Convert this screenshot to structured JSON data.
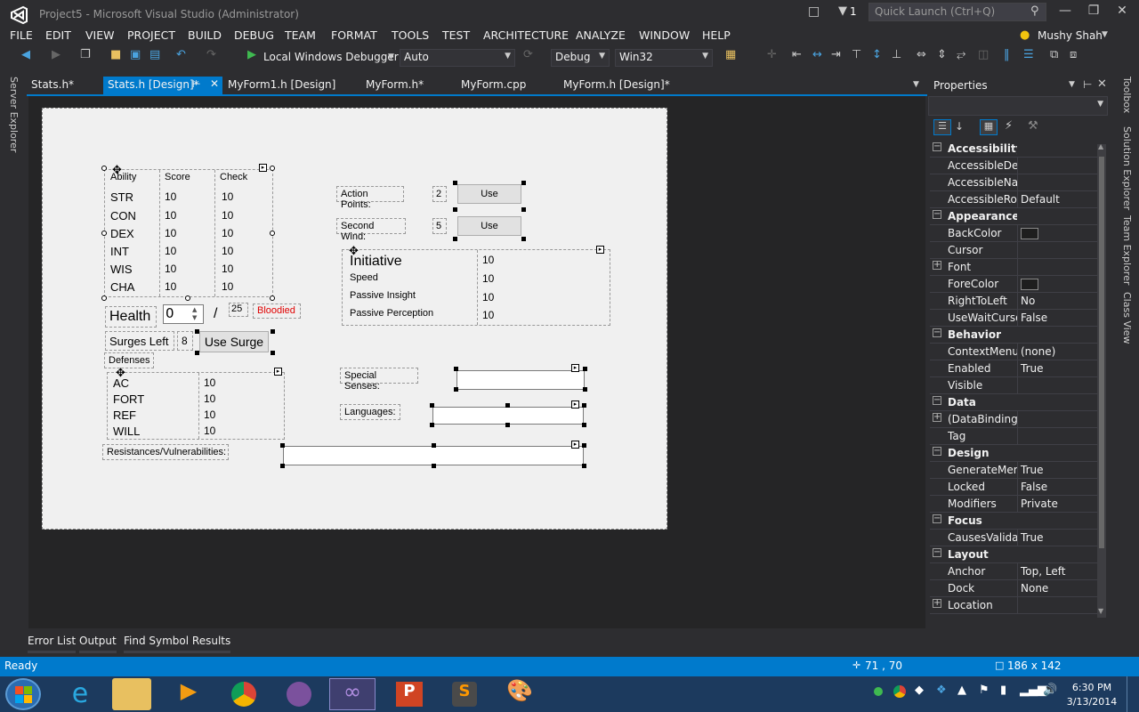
{
  "window": {
    "title": "Project5 - Microsoft Visual Studio (Administrator)",
    "notification_count": "1",
    "quick_launch_placeholder": "Quick Launch (Ctrl+Q)"
  },
  "menu": [
    "FILE",
    "EDIT",
    "VIEW",
    "PROJECT",
    "BUILD",
    "DEBUG",
    "TEAM",
    "FORMAT",
    "TOOLS",
    "TEST",
    "ARCHITECTURE",
    "ANALYZE",
    "WINDOW",
    "HELP"
  ],
  "user": "Mushy Shah",
  "toolbar": {
    "debugger": "Local Windows Debugger",
    "solution_platform_combo": "Auto",
    "config": "Debug",
    "platform": "Win32"
  },
  "side_panel_left": "Server Explorer",
  "tabs": [
    "Stats.h*",
    "Stats.h [Design]*",
    "MyForm1.h [Design]",
    "MyForm.h*",
    "MyForm.cpp",
    "MyForm.h [Design]*"
  ],
  "form": {
    "ability_table": {
      "headers": [
        "Ability",
        "Score",
        "Check"
      ],
      "rows": [
        [
          "STR",
          "10",
          "10"
        ],
        [
          "CON",
          "10",
          "10"
        ],
        [
          "DEX",
          "10",
          "10"
        ],
        [
          "INT",
          "10",
          "10"
        ],
        [
          "WIS",
          "10",
          "10"
        ],
        [
          "CHA",
          "10",
          "10"
        ]
      ]
    },
    "health_label": "Health",
    "health_value": "0",
    "health_sep": "/",
    "health_max": "25",
    "bloodied": "Bloodied",
    "surges_label": "Surges Left",
    "surges_value": "8",
    "use_surge": "Use Surge",
    "defenses_label": "Defenses",
    "defenses_table": [
      [
        "AC",
        "10"
      ],
      [
        "FORT",
        "10"
      ],
      [
        "REF",
        "10"
      ],
      [
        "WILL",
        "10"
      ]
    ],
    "resistances_label": "Resistances/Vulnerabilities:",
    "action_points_label": "Action Points:",
    "action_points_value": "2",
    "second_wind_label": "Second Wind:",
    "second_wind_value": "5",
    "use_label": "Use",
    "initiative_table": [
      [
        "Initiative",
        "10"
      ],
      [
        "Speed",
        "10"
      ],
      [
        "Passive Insight",
        "10"
      ],
      [
        "Passive Perception",
        "10"
      ]
    ],
    "special_senses_label": "Special Senses:",
    "languages_label": "Languages:"
  },
  "properties": {
    "title": "Properties",
    "rows": [
      {
        "cat": "Accessibility"
      },
      {
        "name": "AccessibleDesc",
        "value": ""
      },
      {
        "name": "AccessibleNam",
        "value": ""
      },
      {
        "name": "AccessibleRole",
        "value": "Default"
      },
      {
        "cat": "Appearance"
      },
      {
        "name": "BackColor",
        "value": "",
        "swatch": true
      },
      {
        "name": "Cursor",
        "value": ""
      },
      {
        "name": "Font",
        "value": "",
        "expand": true
      },
      {
        "name": "ForeColor",
        "value": "",
        "swatch": true
      },
      {
        "name": "RightToLeft",
        "value": "No"
      },
      {
        "name": "UseWaitCursor",
        "value": "False"
      },
      {
        "cat": "Behavior"
      },
      {
        "name": "ContextMenuS",
        "value": "(none)"
      },
      {
        "name": "Enabled",
        "value": "True"
      },
      {
        "name": "Visible",
        "value": ""
      },
      {
        "cat": "Data"
      },
      {
        "name": "(DataBindings)",
        "value": "",
        "expand": true
      },
      {
        "name": "Tag",
        "value": ""
      },
      {
        "cat": "Design"
      },
      {
        "name": "GenerateMeml",
        "value": "True"
      },
      {
        "name": "Locked",
        "value": "False"
      },
      {
        "name": "Modifiers",
        "value": "Private"
      },
      {
        "cat": "Focus"
      },
      {
        "name": "CausesValidati",
        "value": "True"
      },
      {
        "cat": "Layout"
      },
      {
        "name": "Anchor",
        "value": "Top, Left"
      },
      {
        "name": "Dock",
        "value": "None"
      },
      {
        "name": "Location",
        "value": "",
        "expand": true
      }
    ]
  },
  "right_strip": [
    "Toolbox",
    "Solution Explorer",
    "Team Explorer",
    "Class View"
  ],
  "bottom_tabs": [
    "Error List",
    "Output",
    "Find Symbol Results"
  ],
  "status": {
    "text": "Ready",
    "position": "71 , 70",
    "size": "186 x 142"
  },
  "taskbar": {
    "time": "6:30 PM",
    "date": "3/13/2014"
  },
  "colors": {
    "accent": "#007acc",
    "chrome": "#2d2d30",
    "editor": "#252526",
    "form_bg": "#f0f0f0",
    "bloodied": "#e00000",
    "taskbar": "#1c3a5e"
  }
}
